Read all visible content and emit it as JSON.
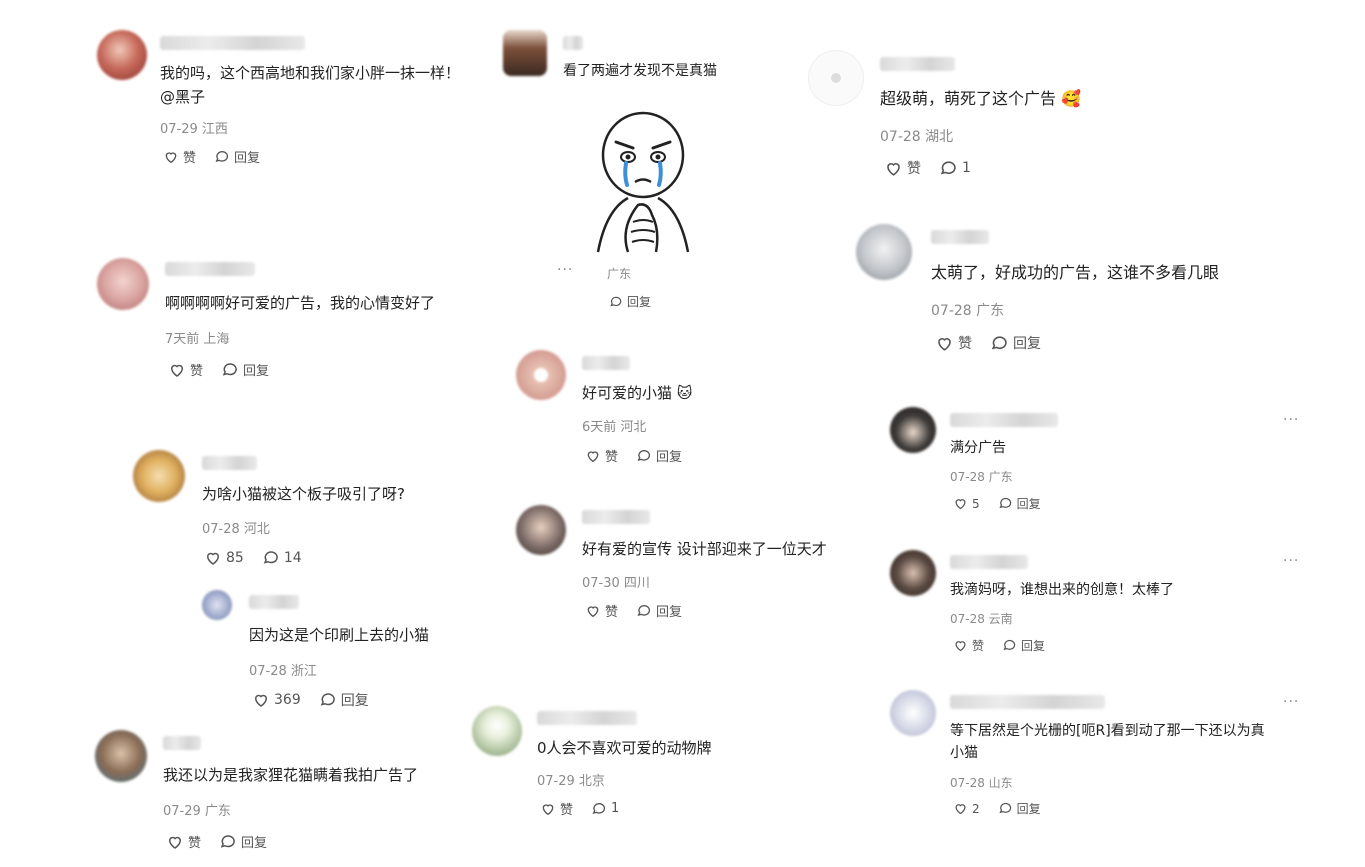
{
  "labels": {
    "like": "赞",
    "reply": "回复"
  },
  "comments": [
    {
      "text": "我的吗，这个西高地和我们家小胖一抹一样！",
      "text2": "@黑子",
      "meta": "07-29 江西",
      "like": "赞",
      "reply": "回复"
    },
    {
      "text": "啊啊啊啊好可爱的广告，我的心情变好了",
      "meta": "7天前 上海",
      "like": "赞",
      "reply": "回复"
    },
    {
      "text": "为啥小猫被这个板子吸引了呀?",
      "meta": "07-28 河北",
      "like": "85",
      "reply": "14"
    },
    {
      "text": "因为这是个印刷上去的小猫",
      "meta": "07-28 浙江",
      "like": "369",
      "reply": "回复"
    },
    {
      "text": "我还以为是我家狸花猫瞒着我拍广告了",
      "meta": "07-29 广东",
      "like": "赞",
      "reply": "回复"
    },
    {
      "text": "看了两遍才发现不是真猫",
      "meta": "广东",
      "like": "",
      "reply": "回复"
    },
    {
      "text": "好可爱的小猫 🐱",
      "meta": "6天前 河北",
      "like": "赞",
      "reply": "回复"
    },
    {
      "text": "好有爱的宣传 设计部迎来了一位天才",
      "meta": "07-30 四川",
      "like": "赞",
      "reply": "回复"
    },
    {
      "text": "0人会不喜欢可爱的动物牌",
      "meta": "07-29 北京",
      "like": "赞",
      "reply": "1"
    },
    {
      "text": "超级萌，萌死了这个广告 🥰",
      "meta": "07-28 湖北",
      "like": "赞",
      "reply": "1"
    },
    {
      "text": "太萌了，好成功的广告，这谁不多看几眼",
      "meta": "07-28 广东",
      "like": "赞",
      "reply": "回复"
    },
    {
      "text": "满分广告",
      "meta": "07-28 广东",
      "like": "5",
      "reply": "回复"
    },
    {
      "text": "我滴妈呀，谁想出来的创意！太棒了",
      "meta": "07-28 云南",
      "like": "赞",
      "reply": "回复"
    },
    {
      "text": "等下居然是个光栅的[呃R]看到动了那一下还以为真",
      "text2": "小猫",
      "meta": "07-28 山东",
      "like": "2",
      "reply": "回复"
    }
  ],
  "colors": {
    "avatar_palette": [
      "#c76b5c",
      "#d9a3a0",
      "#e0b060",
      "#9aa6c9",
      "#8a6c55",
      "#d8a49a",
      "#e6c0b0",
      "#7b6a66",
      "#b8c9a8",
      "#e5e5e5",
      "#bfc3c8",
      "#3d3a38",
      "#5a4a42",
      "#d6d9e6"
    ]
  },
  "sticker": {
    "icon": "crying-meme-sticker"
  },
  "ellipsis": "···"
}
